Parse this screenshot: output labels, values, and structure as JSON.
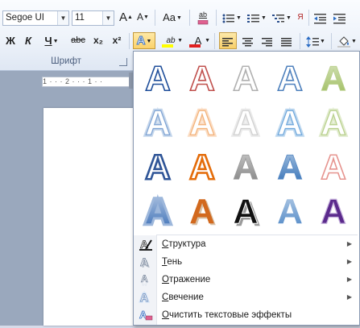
{
  "ribbon": {
    "font_name": "Segoe UI",
    "font_size": "11",
    "grow_font_label": "A",
    "shrink_font_label": "A",
    "change_case_label": "Aa",
    "clear_format_label": "ab",
    "bold_label": "Ж",
    "italic_label": "К",
    "underline_label": "Ч",
    "strike_label": "abc",
    "subscript_label": "x₂",
    "superscript_label": "x²",
    "text_effects_label": "A",
    "highlight_label": "ab",
    "font_color_label": "A",
    "group_label": "Шрифт",
    "highlight_color": "#ffff00",
    "font_color": "#e01f1f"
  },
  "ruler": {
    "text": "1 · · · 2 · · · 1 · ·"
  },
  "gallery": {
    "letter": "A",
    "rows": [
      [
        {
          "style": "outline",
          "color": "#1f4e9a"
        },
        {
          "style": "outline",
          "color": "#c0504d"
        },
        {
          "style": "outline",
          "color": "#b0b0b0"
        },
        {
          "style": "outline",
          "color": "#4f81bd"
        },
        {
          "style": "fill",
          "color": "#9bbb59"
        }
      ],
      [
        {
          "style": "soft",
          "color": "#7ea3d3"
        },
        {
          "style": "soft",
          "color": "#f3b279"
        },
        {
          "style": "soft",
          "color": "#d0d0d0"
        },
        {
          "style": "soft",
          "color": "#6fa8dc"
        },
        {
          "style": "soft",
          "color": "#b8d08c"
        }
      ],
      [
        {
          "style": "bold-outline",
          "color": "#2f5597"
        },
        {
          "style": "bold-outline",
          "color": "#e46c0a"
        },
        {
          "style": "gradient",
          "color": "#7f7f7f"
        },
        {
          "style": "gradient",
          "color": "#2e6db5"
        },
        {
          "style": "outline",
          "color": "#e6948f"
        }
      ],
      [
        {
          "style": "glow",
          "color": "#3b6fb6"
        },
        {
          "style": "solid",
          "color": "#d2691e"
        },
        {
          "style": "shadow",
          "color": "#111111"
        },
        {
          "style": "solid-light",
          "color": "#4a84c4"
        },
        {
          "style": "solid-purple",
          "color": "#5b2a8c"
        }
      ]
    ]
  },
  "menu": {
    "items": [
      {
        "label": "Структура",
        "icon": "outline-icon",
        "has_submenu": true
      },
      {
        "label": "Тень",
        "icon": "shadow-icon",
        "has_submenu": true
      },
      {
        "label": "Отражение",
        "icon": "reflection-icon",
        "has_submenu": true
      },
      {
        "label": "Свечение",
        "icon": "glow-icon",
        "has_submenu": true
      },
      {
        "label": "Очистить текстовые эффекты",
        "icon": "clear-effects-icon",
        "has_submenu": false
      }
    ],
    "submenu_glyph": "▶"
  },
  "colors": {
    "accent": "#f7cf6a",
    "ribbon_border": "#b3c2d8"
  }
}
